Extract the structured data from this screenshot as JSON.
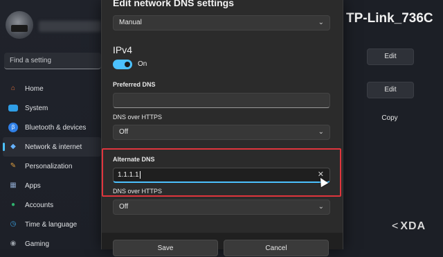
{
  "sidebar": {
    "search_placeholder": "Find a setting",
    "items": [
      {
        "label": "Home",
        "icon": "home-icon",
        "color": "#e2703a"
      },
      {
        "label": "System",
        "icon": "monitor-icon",
        "color": "#2f9ee6"
      },
      {
        "label": "Bluetooth & devices",
        "icon": "bluetooth-icon",
        "color": "#2f7fe6"
      },
      {
        "label": "Network & internet",
        "icon": "network-icon",
        "color": "#66b3ff"
      },
      {
        "label": "Personalization",
        "icon": "brush-icon",
        "color": "#e0a040"
      },
      {
        "label": "Apps",
        "icon": "apps-icon",
        "color": "#8aa4c8"
      },
      {
        "label": "Accounts",
        "icon": "person-icon",
        "color": "#2fb36e"
      },
      {
        "label": "Time & language",
        "icon": "globe-clock-icon",
        "color": "#3aa0e0"
      },
      {
        "label": "Gaming",
        "icon": "gamepad-icon",
        "color": "#9aa0a8"
      }
    ]
  },
  "right_panel": {
    "network_name": "TP-Link_736C",
    "buttons": [
      "Edit",
      "Edit",
      "Copy"
    ]
  },
  "dialog": {
    "title": "Edit network DNS settings",
    "mode_value": "Manual",
    "ipv4_heading": "IPv4",
    "toggle_label": "On",
    "preferred_dns_label": "Preferred DNS",
    "preferred_dns_value": "",
    "dns_over_https_label_1": "DNS over HTTPS",
    "dns_over_https_value_1": "Off",
    "alternate_dns_label": "Alternate DNS",
    "alternate_dns_value": "1.1.1.1",
    "dns_over_https_label_2": "DNS over HTTPS",
    "dns_over_https_value_2": "Off",
    "save_label": "Save",
    "cancel_label": "Cancel"
  },
  "watermark": {
    "mark": "<",
    "text": "XDA"
  },
  "colors": {
    "accent": "#4cc2ff",
    "highlight": "#e0353d"
  }
}
